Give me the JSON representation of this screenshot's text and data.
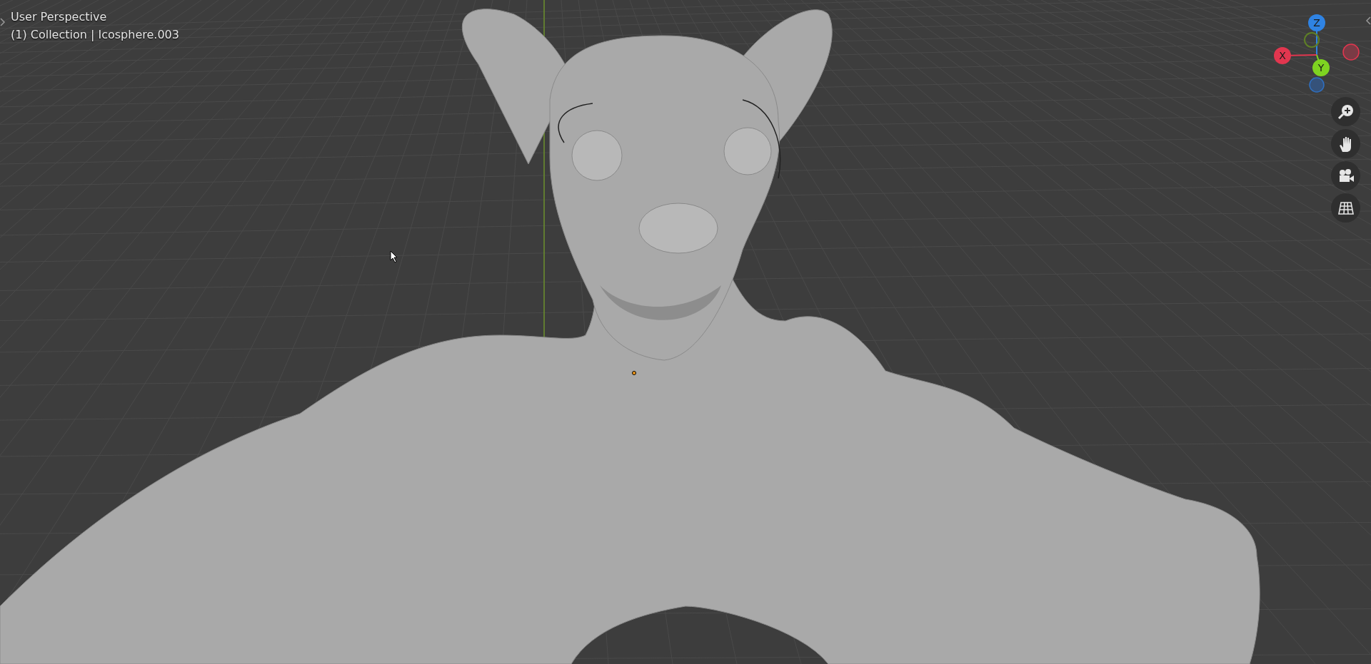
{
  "viewport": {
    "view_name": "User Perspective",
    "object_info": "(1) Collection | Icosphere.003"
  },
  "gizmo": {
    "axes": [
      {
        "label": "Z",
        "color": "#2f83e3"
      },
      {
        "label": "X",
        "color": "#e2364f"
      },
      {
        "label": "Y",
        "color": "#7ed321"
      }
    ]
  }
}
